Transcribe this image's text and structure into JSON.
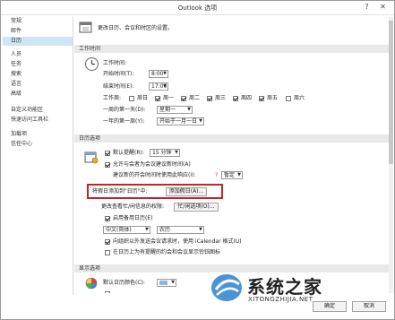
{
  "window": {
    "title": "Outlook 选项",
    "help": "?",
    "close": "✕"
  },
  "sidebar": {
    "items": [
      {
        "label": "常规"
      },
      {
        "label": "邮件"
      },
      {
        "label": "日历"
      },
      {
        "label": "人员"
      },
      {
        "label": "任务"
      },
      {
        "label": "搜索"
      },
      {
        "label": "语言"
      },
      {
        "label": "高级"
      },
      {
        "label": "自定义功能区"
      },
      {
        "label": "快速访问工具栏"
      },
      {
        "label": "加载项"
      },
      {
        "label": "信任中心"
      }
    ],
    "selected_index": 2
  },
  "header": {
    "text": "更改日历、会议和时区的设置。"
  },
  "work_time": {
    "title": "工作时间",
    "label": "工作时间:",
    "start_label": "开始时间(T):",
    "start_value": "8:00",
    "end_label": "结束时间(E):",
    "end_value": "17:00",
    "week_label": "工作周:",
    "days": [
      {
        "label": "周日",
        "checked": false
      },
      {
        "label": "周一",
        "checked": true
      },
      {
        "label": "周二",
        "checked": true
      },
      {
        "label": "周三",
        "checked": true
      },
      {
        "label": "周四",
        "checked": true
      },
      {
        "label": "周五",
        "checked": true
      },
      {
        "label": "周六",
        "checked": false
      }
    ],
    "first_day_label": "一周的第一天(D):",
    "first_day_value": "星期一",
    "first_week_label": "一年的第一周(Y):",
    "first_week_value": "开始于一月一日"
  },
  "calendar_options": {
    "title": "日历选项",
    "reminder_label": "默认提醒(R):",
    "reminder_value": "15 分钟",
    "allow_propose_label": "允许与会者为会议建议新时间(A)",
    "propose_response_label": "建议新的开会时间时使用此响应(I):",
    "propose_response_value": "暂定",
    "add_holidays_label": "将假日添加到\"日历\"中:",
    "add_holidays_button": "添加假日(A)...",
    "free_busy_label": "更改查看忙/闲信息的权限:",
    "free_busy_button": "忙/闲选项(O)...",
    "alt_calendar_label": "启用备用日历(E)",
    "lang_value": "中文(简体)",
    "type_value": "农历",
    "icalendar_label": "向组织以外发送会议请求时，使用 iCalendar 格式(U)",
    "bell_label": "在日历上为有提醒的约会和会议显示铃铛图标"
  },
  "display_options": {
    "title": "显示选项",
    "default_color_label": "默认日历颜色(C):"
  },
  "footer": {
    "ok": "确定",
    "cancel": "取消"
  },
  "watermark": {
    "text": "系统之家",
    "url": "XITONGZHIJIA.NET"
  },
  "colors": {
    "selected": "#cde6f7",
    "highlight": "#c9202a",
    "section": "#e9e9e9"
  }
}
